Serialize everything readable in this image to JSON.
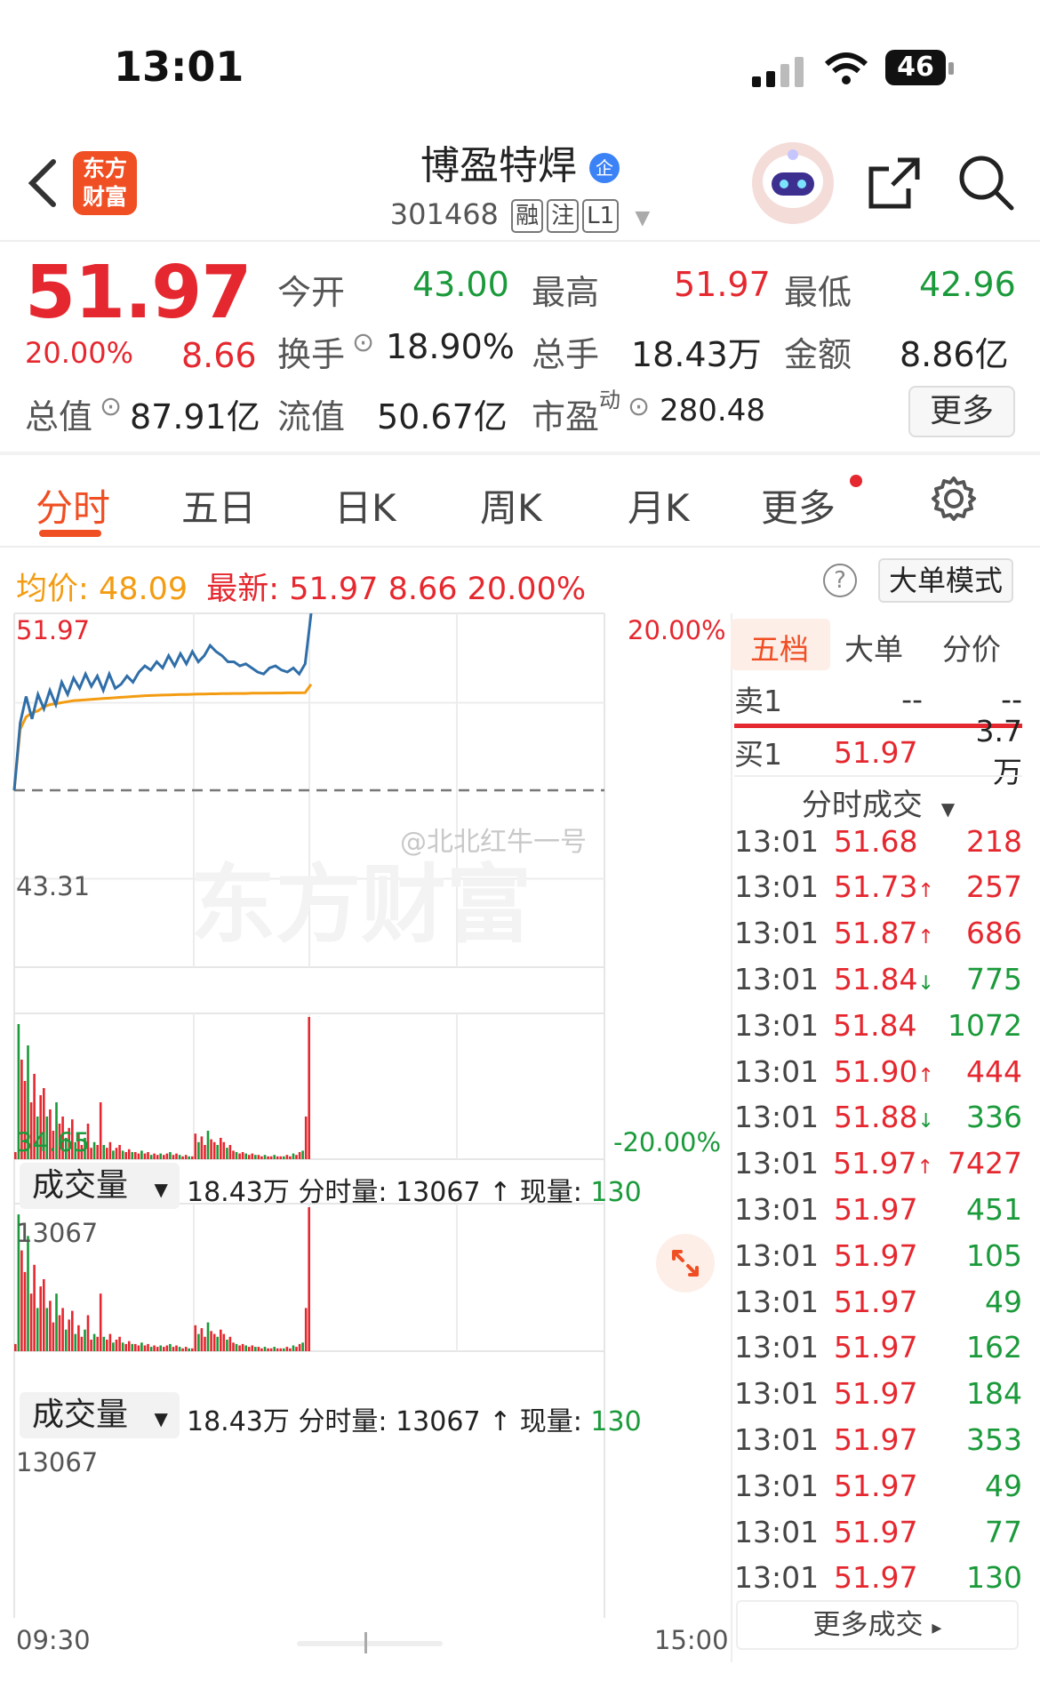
{
  "status_bar": {
    "time": "13:01",
    "battery": "46"
  },
  "header": {
    "title": "博盈特焊",
    "code": "301468",
    "tags": [
      "融",
      "注",
      "L1"
    ],
    "verified_badge": "企"
  },
  "logo": {
    "line1": "东方",
    "line2": "财富"
  },
  "quote": {
    "price": "51.97",
    "change_pct": "20.00%",
    "change": "8.66",
    "open_label": "今开",
    "open": "43.00",
    "high_label": "最高",
    "high": "51.97",
    "low_label": "最低",
    "low": "42.96",
    "turnover_label": "换手",
    "turnover": "18.90%",
    "volume_label": "总手",
    "volume": "18.43万",
    "amount_label": "金额",
    "amount": "8.86亿",
    "mktcap_label": "总值",
    "mktcap": "87.91亿",
    "float_label": "流值",
    "float": "50.67亿",
    "pe_label": "市盈",
    "pe_sup": "动",
    "pe": "280.48",
    "more_button": "更多"
  },
  "tabs": [
    "分时",
    "五日",
    "日K",
    "周K",
    "月K",
    "更多"
  ],
  "info_line": {
    "avg_label": "均价:",
    "avg": "48.09",
    "latest_label": "最新:",
    "latest": "51.97",
    "latest_change": "8.66",
    "latest_pct": "20.00%",
    "mode_button": "大单模式"
  },
  "chart_data": {
    "type": "line",
    "y_top": "51.97",
    "y_prev_close": "43.31",
    "y_bottom": "34.65",
    "pct_top": "20.00%",
    "pct_bottom": "-20.00%",
    "ylim": [
      34.65,
      51.97
    ],
    "x_start": "09:30",
    "x_end": "15:00",
    "series": [
      {
        "values": [
          43.3,
          46.6,
          47.9,
          46.8,
          48.0,
          47.3,
          48.2,
          47.5,
          48.6,
          48.0,
          48.8,
          48.3,
          49.0,
          48.4,
          48.9,
          48.2,
          49.0,
          48.3,
          48.5,
          48.9,
          48.6,
          49.1,
          49.4,
          49.2,
          49.6,
          49.3,
          49.9,
          49.4,
          50.0,
          49.5,
          50.1,
          49.6,
          49.9,
          50.4,
          50.1,
          49.9,
          49.6,
          49.6,
          49.4,
          49.5,
          49.3,
          49.1,
          49.0,
          49.3,
          49.4,
          49.2,
          49.1,
          49.3,
          49.0,
          49.5,
          51.97
        ]
      },
      {
        "values": [
          43.3,
          46.3,
          46.9,
          47.1,
          47.2,
          47.4,
          47.5,
          47.55,
          47.6,
          47.65,
          47.7,
          47.72,
          47.74,
          47.76,
          47.78,
          47.8,
          47.82,
          47.84,
          47.86,
          47.88,
          47.9,
          47.92,
          47.94,
          47.95,
          47.96,
          47.97,
          47.98,
          47.99,
          48.0,
          48.0,
          48.01,
          48.02,
          48.02,
          48.03,
          48.03,
          48.04,
          48.04,
          48.05,
          48.05,
          48.05,
          48.06,
          48.06,
          48.06,
          48.07,
          48.07,
          48.07,
          48.08,
          48.08,
          48.08,
          48.09,
          48.5
        ]
      }
    ]
  },
  "volume_panels": [
    {
      "selector": "成交量",
      "total": "18.43万",
      "minute_label": "分时量:",
      "minute": "13067",
      "arrow": "↑",
      "current_label": "现量:",
      "current": "130",
      "ymax": "13067"
    },
    {
      "selector": "成交量",
      "total": "18.43万",
      "minute_label": "分时量:",
      "minute": "13067",
      "arrow": "↑",
      "current_label": "现量:",
      "current": "130",
      "ymax": "13067"
    }
  ],
  "volume_bars": [
    0.05,
    0.95,
    0.7,
    0.55,
    0.8,
    0.4,
    0.6,
    0.3,
    0.45,
    0.5,
    0.3,
    0.35,
    0.2,
    0.4,
    0.25,
    0.3,
    0.15,
    0.22,
    0.28,
    0.12,
    0.18,
    0.1,
    0.15,
    0.25,
    0.08,
    0.12,
    0.1,
    0.4,
    0.1,
    0.08,
    0.12,
    0.06,
    0.08,
    0.1,
    0.06,
    0.05,
    0.07,
    0.05,
    0.05,
    0.04,
    0.06,
    0.04,
    0.05,
    0.03,
    0.04,
    0.03,
    0.04,
    0.03,
    0.04,
    0.05,
    0.03,
    0.04,
    0.03,
    0.02,
    0.03,
    0.02,
    0.02,
    0.18,
    0.12,
    0.16,
    0.1,
    0.2,
    0.14,
    0.12,
    0.1,
    0.15,
    0.12,
    0.08,
    0.1,
    0.06,
    0.05,
    0.04,
    0.05,
    0.04,
    0.03,
    0.04,
    0.03,
    0.03,
    0.02,
    0.03,
    0.02,
    0.02,
    0.03,
    0.02,
    0.02,
    0.02,
    0.03,
    0.02,
    0.04,
    0.03,
    0.05,
    0.06,
    0.3,
    1.0
  ],
  "order_book": {
    "tabs": [
      "五档",
      "大单",
      "分价"
    ],
    "sell1_label": "卖1",
    "sell1_price": "--",
    "sell1_vol": "--",
    "buy1_label": "买1",
    "buy1_price": "51.97",
    "buy1_vol": "3.7万",
    "trades_title": "分时成交",
    "trades": [
      {
        "time": "13:01",
        "price": "51.68",
        "arrow": "",
        "vol": "218",
        "dir": "up"
      },
      {
        "time": "13:01",
        "price": "51.73",
        "arrow": "↑",
        "vol": "257",
        "dir": "up"
      },
      {
        "time": "13:01",
        "price": "51.87",
        "arrow": "↑",
        "vol": "686",
        "dir": "up"
      },
      {
        "time": "13:01",
        "price": "51.84",
        "arrow": "↓",
        "vol": "775",
        "dir": "down"
      },
      {
        "time": "13:01",
        "price": "51.84",
        "arrow": "",
        "vol": "1072",
        "dir": "down"
      },
      {
        "time": "13:01",
        "price": "51.90",
        "arrow": "↑",
        "vol": "444",
        "dir": "up"
      },
      {
        "time": "13:01",
        "price": "51.88",
        "arrow": "↓",
        "vol": "336",
        "dir": "down"
      },
      {
        "time": "13:01",
        "price": "51.97",
        "arrow": "↑",
        "vol": "7427",
        "dir": "up"
      },
      {
        "time": "13:01",
        "price": "51.97",
        "arrow": "",
        "vol": "451",
        "dir": "down"
      },
      {
        "time": "13:01",
        "price": "51.97",
        "arrow": "",
        "vol": "105",
        "dir": "down"
      },
      {
        "time": "13:01",
        "price": "51.97",
        "arrow": "",
        "vol": "49",
        "dir": "down"
      },
      {
        "time": "13:01",
        "price": "51.97",
        "arrow": "",
        "vol": "162",
        "dir": "down"
      },
      {
        "time": "13:01",
        "price": "51.97",
        "arrow": "",
        "vol": "184",
        "dir": "down"
      },
      {
        "time": "13:01",
        "price": "51.97",
        "arrow": "",
        "vol": "353",
        "dir": "down"
      },
      {
        "time": "13:01",
        "price": "51.97",
        "arrow": "",
        "vol": "49",
        "dir": "down"
      },
      {
        "time": "13:01",
        "price": "51.97",
        "arrow": "",
        "vol": "77",
        "dir": "down"
      },
      {
        "time": "13:01",
        "price": "51.97",
        "arrow": "",
        "vol": "130",
        "dir": "down"
      }
    ],
    "more_trades": "更多成交"
  },
  "watermark": {
    "text1": "东方财富",
    "text2": "@北北红牛一号"
  },
  "colors": {
    "up": "#e5282f",
    "down": "#1a9a3a",
    "price_line": "#2f6ea8",
    "avg_line": "#f39c12",
    "accent": "#f04e23"
  }
}
